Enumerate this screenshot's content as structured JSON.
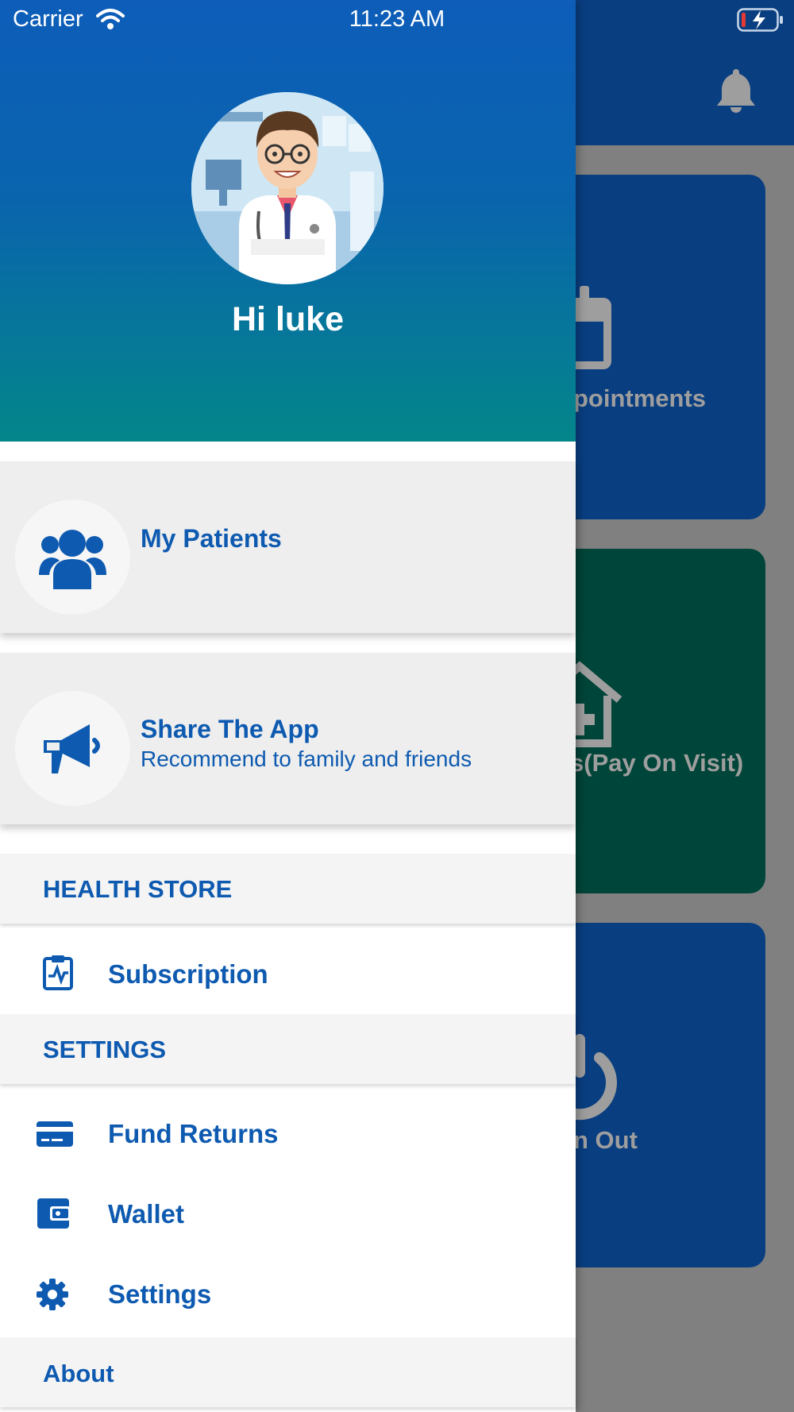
{
  "status_bar": {
    "carrier": "Carrier",
    "time": "11:23 AM"
  },
  "background": {
    "cards": [
      {
        "label": "pointments",
        "color": "#093e80"
      },
      {
        "label": "s(Pay On Visit)",
        "color": "#004539"
      },
      {
        "label": "n Out",
        "color": "#093e80"
      }
    ]
  },
  "drawer": {
    "greeting": "Hi luke",
    "cards": [
      {
        "title": "My Patients",
        "icon": "users-icon"
      },
      {
        "title": "Share The App",
        "subtitle": "Recommend to family and friends",
        "icon": "megaphone-icon"
      }
    ],
    "sections": {
      "health_store": "HEALTH STORE",
      "settings": "SETTINGS",
      "about": "About"
    },
    "menu": {
      "subscription": "Subscription",
      "fund_returns": "Fund Returns",
      "wallet": "Wallet",
      "settings": "Settings"
    }
  },
  "colors": {
    "accent": "#0d5ab0",
    "header_top": "#0d5db9",
    "header_bottom": "#03868a"
  }
}
